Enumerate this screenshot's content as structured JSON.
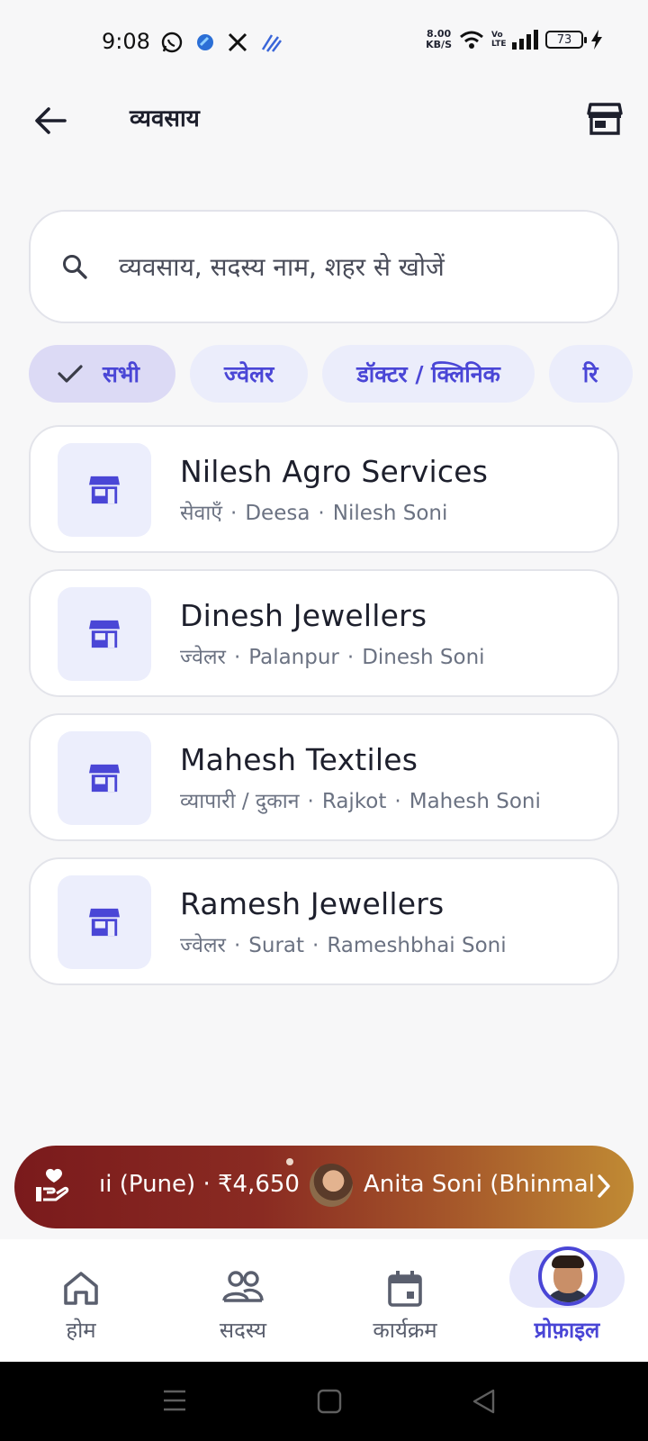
{
  "status_bar": {
    "time": "9:08",
    "net_speed_value": "8.00",
    "net_speed_unit": "KB/S",
    "volte": "Vo LTE",
    "battery": "73"
  },
  "header": {
    "title": "व्यवसाय"
  },
  "search": {
    "placeholder": "व्यवसाय, सदस्य नाम, शहर से खोजें"
  },
  "filters": [
    {
      "label": "सभी",
      "selected": true
    },
    {
      "label": "ज्वेलर",
      "selected": false
    },
    {
      "label": "डॉक्टर / क्लिनिक",
      "selected": false
    },
    {
      "label": "रि",
      "selected": false
    }
  ],
  "businesses": [
    {
      "name": "Nilesh Agro Services",
      "category": "सेवाएँ",
      "city": "Deesa",
      "owner": "Nilesh Soni"
    },
    {
      "name": "Dinesh Jewellers",
      "category": "ज्वेलर",
      "city": "Palanpur",
      "owner": "Dinesh Soni"
    },
    {
      "name": "Mahesh Textiles",
      "category": "व्यापारी / दुकान",
      "city": "Rajkot",
      "owner": "Mahesh Soni"
    },
    {
      "name": "Ramesh Jewellers",
      "category": "ज्वेलर",
      "city": "Surat",
      "owner": "Rameshbhai Soni"
    }
  ],
  "separator": "·",
  "ticker": {
    "item1": "ıi (Pune) · ₹4,650",
    "item2": "Anita Soni (Bhinmal"
  },
  "bottom_nav": [
    {
      "label": "होम",
      "icon": "home-icon",
      "active": false
    },
    {
      "label": "सदस्य",
      "icon": "members-icon",
      "active": false
    },
    {
      "label": "कार्यक्रम",
      "icon": "calendar-icon",
      "active": false
    },
    {
      "label": "प्रोफ़ाइल",
      "icon": "profile-avatar",
      "active": true
    }
  ],
  "colors": {
    "accent": "#4a46d6",
    "chip_bg": "#ebedfb",
    "chip_selected_bg": "#dcdaf5",
    "ticker_start": "#7a1a1c",
    "ticker_end": "#c08a34"
  }
}
